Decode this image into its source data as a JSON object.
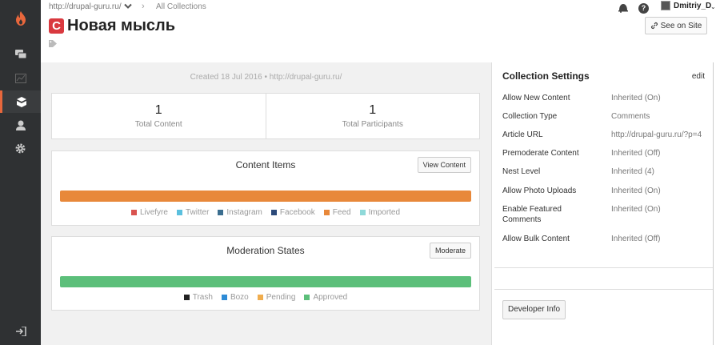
{
  "breadcrumb": {
    "site": "http://drupal-guru.ru/",
    "all_collections": "All Collections",
    "separator": "›"
  },
  "user": {
    "name": "Dmitriy_D",
    "chevron": "⌄"
  },
  "help": {
    "glyph": "?"
  },
  "title": {
    "icon_letter": "C",
    "text": "Новая мысль"
  },
  "see_on_site": {
    "label": "See on Site"
  },
  "created": "Created 18 Jul 2016 • http://drupal-guru.ru/",
  "stats": [
    {
      "value": "1",
      "label": "Total Content"
    },
    {
      "value": "1",
      "label": "Total Participants"
    }
  ],
  "content_items": {
    "title": "Content Items",
    "button": "View Content",
    "progress": 1.0,
    "bar_color": "#e8883a",
    "legend": [
      {
        "label": "Livefyre",
        "color": "#d9534f"
      },
      {
        "label": "Twitter",
        "color": "#5bc0de"
      },
      {
        "label": "Instagram",
        "color": "#3b6e8f"
      },
      {
        "label": "Facebook",
        "color": "#2c4a7a"
      },
      {
        "label": "Feed",
        "color": "#e8883a"
      },
      {
        "label": "Imported",
        "color": "#8fd9d9"
      }
    ]
  },
  "moderation": {
    "title": "Moderation States",
    "button": "Moderate",
    "progress": 1.0,
    "bar_color": "#5cbf7a",
    "legend": [
      {
        "label": "Trash",
        "color": "#222222"
      },
      {
        "label": "Bozo",
        "color": "#2e8bd6"
      },
      {
        "label": "Pending",
        "color": "#f0ad4e"
      },
      {
        "label": "Approved",
        "color": "#5cbf7a"
      }
    ]
  },
  "settings": {
    "title": "Collection Settings",
    "edit": "edit",
    "rows": [
      {
        "key": "Allow New Content",
        "value": "Inherited (On)"
      },
      {
        "key": "Collection Type",
        "value": "Comments"
      },
      {
        "key": "Article URL",
        "value": "http://drupal-guru.ru/?p=4"
      },
      {
        "key": "Premoderate Content",
        "value": "Inherited (Off)"
      },
      {
        "key": "Nest Level",
        "value": "Inherited (4)"
      },
      {
        "key": "Allow Photo Uploads",
        "value": "Inherited (On)"
      },
      {
        "key": "Enable Featured Comments",
        "value": "Inherited (On)"
      },
      {
        "key": "Allow Bulk Content",
        "value": "Inherited (Off)"
      }
    ],
    "developer_info": "Developer Info"
  },
  "icons": {
    "logo": "flame-logo-icon",
    "nav": [
      "chat-icon",
      "analytics-icon",
      "collections-icon",
      "user-icon",
      "gear-icon"
    ],
    "logout": "logout-icon"
  },
  "colors": {
    "rail": "#2f3133",
    "accent": "#e8673c",
    "title_icon": "#d9393f"
  }
}
